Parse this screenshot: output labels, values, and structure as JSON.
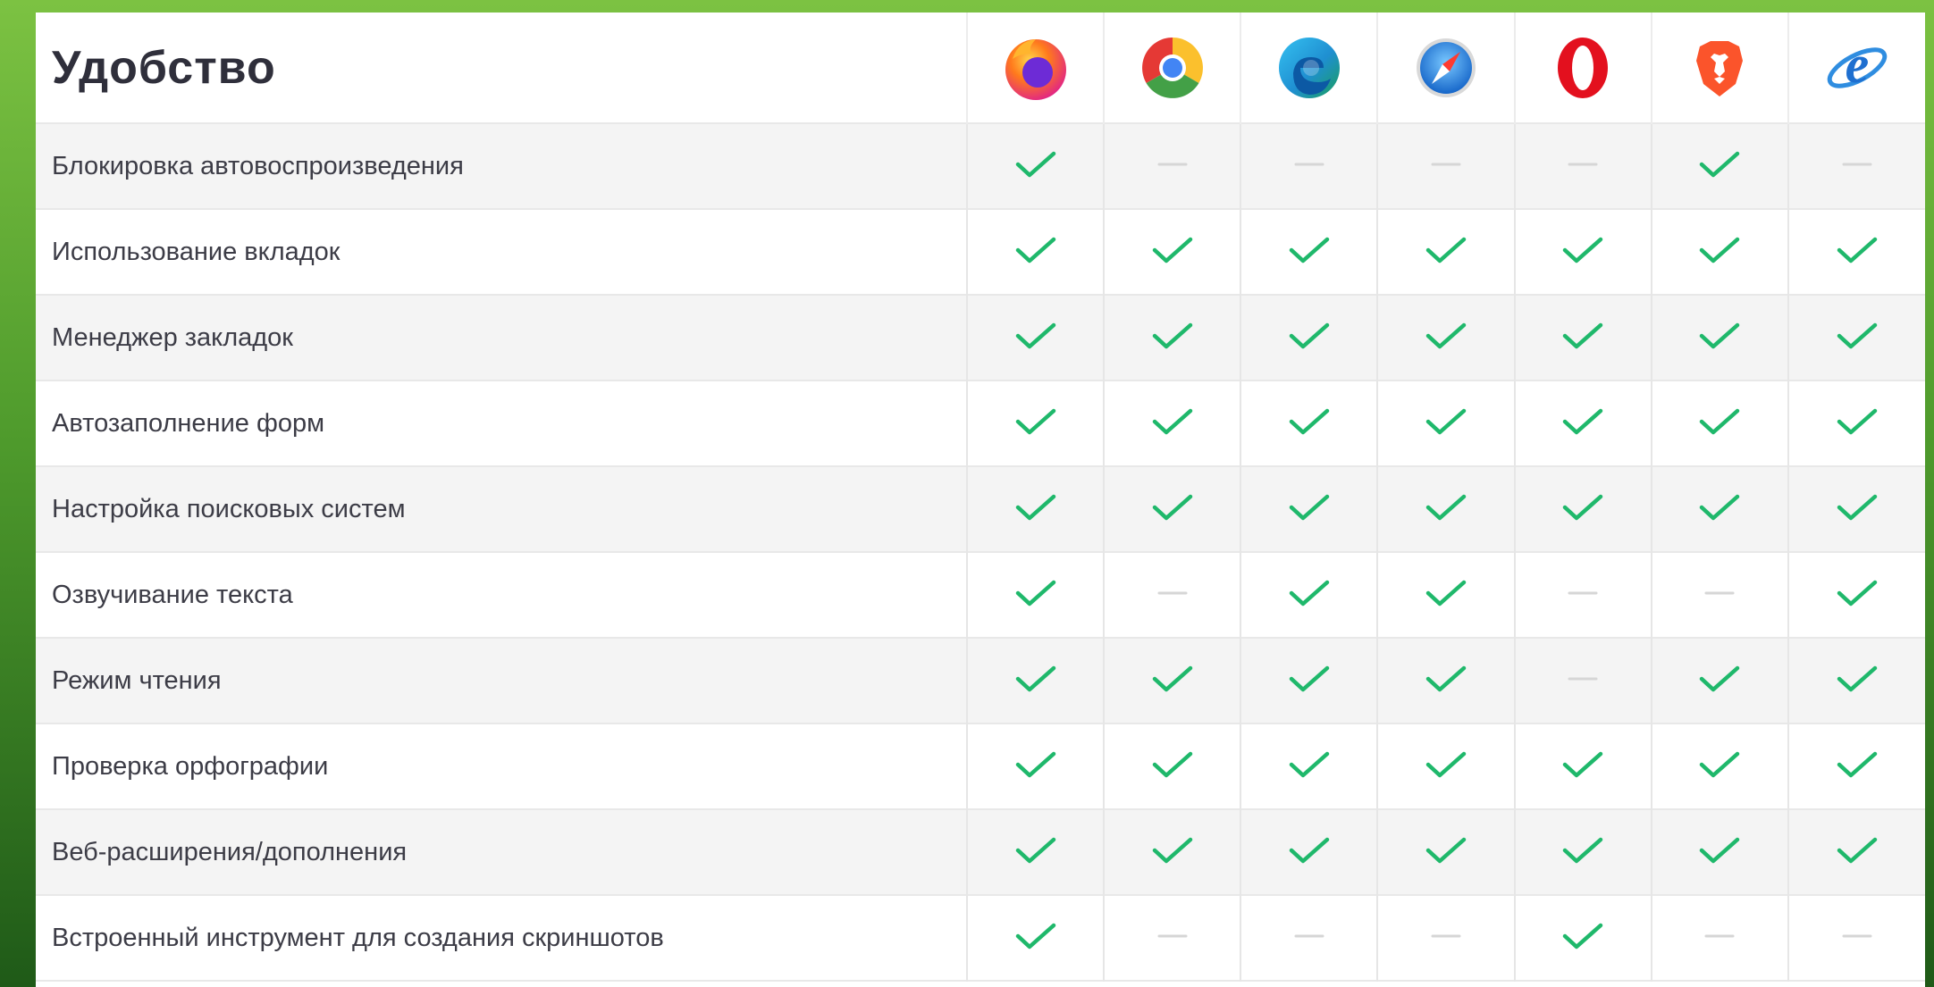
{
  "table": {
    "title": "Удобство",
    "browsers": [
      {
        "name": "firefox-icon"
      },
      {
        "name": "chrome-icon"
      },
      {
        "name": "edge-icon"
      },
      {
        "name": "safari-icon"
      },
      {
        "name": "opera-icon"
      },
      {
        "name": "brave-icon"
      },
      {
        "name": "internet-explorer-icon"
      }
    ],
    "rows": [
      {
        "label": "Блокировка автовоспроизведения",
        "support": [
          true,
          false,
          false,
          false,
          false,
          true,
          false
        ]
      },
      {
        "label": "Использование вкладок",
        "support": [
          true,
          true,
          true,
          true,
          true,
          true,
          true
        ]
      },
      {
        "label": "Менеджер закладок",
        "support": [
          true,
          true,
          true,
          true,
          true,
          true,
          true
        ]
      },
      {
        "label": "Автозаполнение форм",
        "support": [
          true,
          true,
          true,
          true,
          true,
          true,
          true
        ]
      },
      {
        "label": "Настройка поисковых систем",
        "support": [
          true,
          true,
          true,
          true,
          true,
          true,
          true
        ]
      },
      {
        "label": "Озвучивание текста",
        "support": [
          true,
          false,
          true,
          true,
          false,
          false,
          true
        ]
      },
      {
        "label": "Режим чтения",
        "support": [
          true,
          true,
          true,
          true,
          false,
          true,
          true
        ]
      },
      {
        "label": "Проверка орфографии",
        "support": [
          true,
          true,
          true,
          true,
          true,
          true,
          true
        ]
      },
      {
        "label": "Веб-расширения/дополнения",
        "support": [
          true,
          true,
          true,
          true,
          true,
          true,
          true
        ]
      },
      {
        "label": "Встроенный инструмент для создания скриншотов",
        "support": [
          true,
          false,
          false,
          false,
          true,
          false,
          false
        ]
      }
    ]
  },
  "colors": {
    "check": "#1fb86b",
    "dash": "#d6d6d6"
  }
}
